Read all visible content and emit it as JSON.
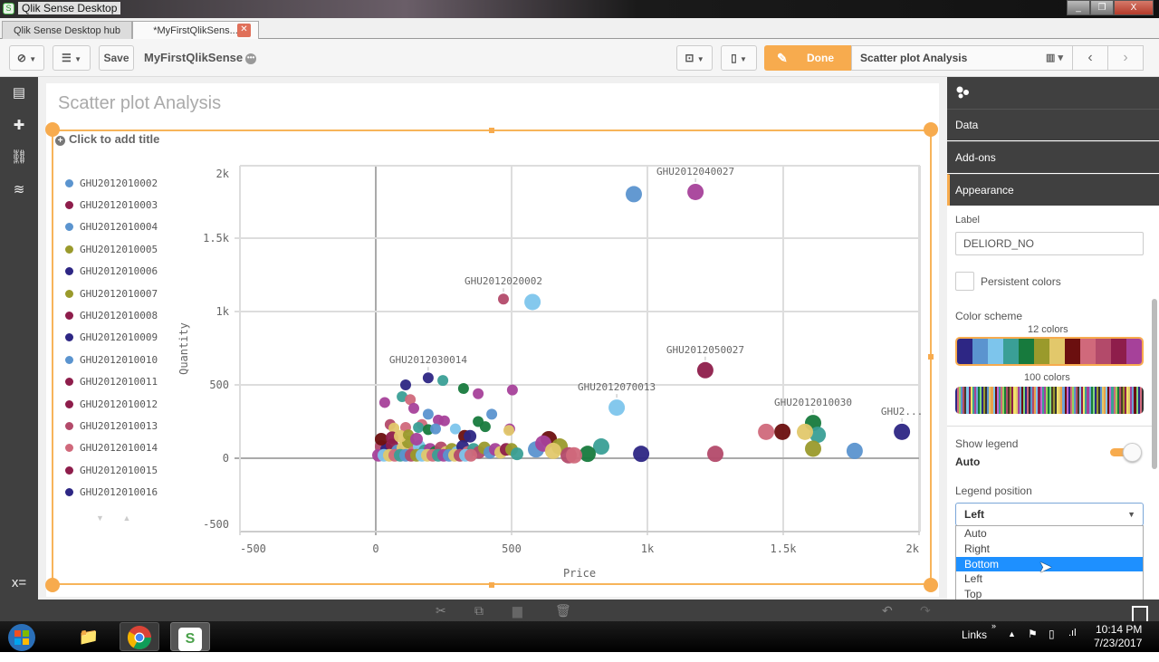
{
  "window": {
    "title": "Qlik Sense Desktop",
    "controls": [
      "minimize",
      "restore",
      "close"
    ]
  },
  "tabs": [
    {
      "label": "Qlik Sense Desktop hub",
      "active": false
    },
    {
      "label": "*MyFirstQlikSens...",
      "active": true,
      "close_icon": "close-icon"
    }
  ],
  "toolbar": {
    "nav_icon": "compass-icon",
    "menu_icon": "list-icon",
    "save_label": "Save",
    "app_name": "MyFirstQlikSense",
    "present_icon": "presentation-icon",
    "bookmark_icon": "bookmark-icon",
    "done_label": "Done",
    "sheet_name": "Scatter plot Analysis",
    "sheet_icon": "chart-icon",
    "prev_icon": "chevron-left-icon",
    "next_icon": "chevron-right-icon",
    "accent_color": "#f7ab4e"
  },
  "leftbar": {
    "icons": [
      "charts-icon",
      "extensions-icon",
      "link-icon",
      "database-icon",
      "variable-icon"
    ]
  },
  "sheet": {
    "title": "Scatter plot Analysis",
    "object_title_placeholder": "Click to add title"
  },
  "legend": {
    "items": [
      {
        "label": "GHU2012010002",
        "color": "#5b94cf"
      },
      {
        "label": "GHU2012010003",
        "color": "#8e1d4b"
      },
      {
        "label": "GHU2012010004",
        "color": "#5b94cf"
      },
      {
        "label": "GHU2012010005",
        "color": "#9a9a2c"
      },
      {
        "label": "GHU2012010006",
        "color": "#2d2684"
      },
      {
        "label": "GHU2012010007",
        "color": "#9a9a2c"
      },
      {
        "label": "GHU2012010008",
        "color": "#8e1d4b"
      },
      {
        "label": "GHU2012010009",
        "color": "#2d2684"
      },
      {
        "label": "GHU2012010010",
        "color": "#5b94cf"
      },
      {
        "label": "GHU2012010011",
        "color": "#8e1d4b"
      },
      {
        "label": "GHU2012010012",
        "color": "#8e1d4b"
      },
      {
        "label": "GHU2012010013",
        "color": "#b34a6a"
      },
      {
        "label": "GHU2012010014",
        "color": "#d0697b"
      },
      {
        "label": "GHU2012010015",
        "color": "#8e1d4b"
      },
      {
        "label": "GHU2012010016",
        "color": "#2d2684"
      }
    ],
    "scroll_down": "▼",
    "scroll_up": "▲"
  },
  "chart_data": {
    "type": "scatter",
    "title": "",
    "xlabel": "Price",
    "ylabel": "Quantity",
    "xlim": [
      -500,
      2000
    ],
    "ylim": [
      -500,
      2000
    ],
    "xticks": [
      {
        "v": -500,
        "label": "-500"
      },
      {
        "v": 0,
        "label": "0"
      },
      {
        "v": 500,
        "label": "500"
      },
      {
        "v": 1000,
        "label": "1k"
      },
      {
        "v": 1500,
        "label": "1.5k"
      },
      {
        "v": 2000,
        "label": "2k"
      }
    ],
    "yticks": [
      {
        "v": -500,
        "label": "-500"
      },
      {
        "v": 0,
        "label": "0"
      },
      {
        "v": 500,
        "label": "500"
      },
      {
        "v": 1000,
        "label": "1k"
      },
      {
        "v": 1500,
        "label": "1.5k"
      },
      {
        "v": 2000,
        "label": "2k"
      }
    ],
    "grid": true,
    "legend_position": "left",
    "points": [
      {
        "x": 950,
        "y": 1800,
        "color": "#5b94cf"
      },
      {
        "x": 1177,
        "y": 1815,
        "color": "#a6419a",
        "label": "GHU2012040027"
      },
      {
        "x": 470,
        "y": 1085,
        "color": "#b34a6a",
        "label": "GHU2012020002"
      },
      {
        "x": 577,
        "y": 1065,
        "color": "#7dc5ec"
      },
      {
        "x": 1213,
        "y": 600,
        "color": "#8e1d4b",
        "label": "GHU2012050027"
      },
      {
        "x": 887,
        "y": 345,
        "color": "#7dc5ec",
        "label": "GHU2012070013"
      },
      {
        "x": 193,
        "y": 548,
        "color": "#2d2684",
        "label": "GHU2012030014"
      },
      {
        "x": 247,
        "y": 530,
        "color": "#3a9f96"
      },
      {
        "x": 323,
        "y": 475,
        "color": "#177a3d"
      },
      {
        "x": 110,
        "y": 500,
        "color": "#2d2684"
      },
      {
        "x": 33,
        "y": 380,
        "color": "#a6419a"
      },
      {
        "x": 97,
        "y": 420,
        "color": "#3a9f96"
      },
      {
        "x": 127,
        "y": 400,
        "color": "#d0697b"
      },
      {
        "x": 377,
        "y": 440,
        "color": "#a6419a"
      },
      {
        "x": 503,
        "y": 465,
        "color": "#a6419a"
      },
      {
        "x": 140,
        "y": 340,
        "color": "#a6419a"
      },
      {
        "x": 193,
        "y": 300,
        "color": "#5b94cf"
      },
      {
        "x": 427,
        "y": 300,
        "color": "#5b94cf"
      },
      {
        "x": 170,
        "y": 230,
        "color": "#d0697b"
      },
      {
        "x": 230,
        "y": 260,
        "color": "#a6419a"
      },
      {
        "x": 253,
        "y": 255,
        "color": "#a6419a"
      },
      {
        "x": 377,
        "y": 250,
        "color": "#177a3d"
      },
      {
        "x": 493,
        "y": 200,
        "color": "#a6419a"
      },
      {
        "x": 157,
        "y": 210,
        "color": "#3a9f96"
      },
      {
        "x": 193,
        "y": 195,
        "color": "#177a3d"
      },
      {
        "x": 220,
        "y": 200,
        "color": "#5b94cf"
      },
      {
        "x": 293,
        "y": 200,
        "color": "#7dc5ec"
      },
      {
        "x": 403,
        "y": 215,
        "color": "#177a3d"
      },
      {
        "x": 490,
        "y": 190,
        "color": "#e2c86b"
      },
      {
        "x": 53,
        "y": 230,
        "color": "#b34a6a"
      },
      {
        "x": 67,
        "y": 205,
        "color": "#e2c86b"
      },
      {
        "x": 110,
        "y": 210,
        "color": "#d0697b"
      },
      {
        "x": 327,
        "y": 150,
        "color": "#6b0f0f"
      },
      {
        "x": 347,
        "y": 150,
        "color": "#2d2684"
      },
      {
        "x": 637,
        "y": 130,
        "color": "#6b0f0f"
      },
      {
        "x": 830,
        "y": 80,
        "color": "#3a9f96"
      },
      {
        "x": 590,
        "y": 60,
        "color": "#5b94cf"
      },
      {
        "x": 617,
        "y": 100,
        "color": "#a6419a"
      },
      {
        "x": 677,
        "y": 80,
        "color": "#9a9a2c"
      },
      {
        "x": 653,
        "y": 50,
        "color": "#e2c86b"
      },
      {
        "x": 780,
        "y": 30,
        "color": "#177a3d"
      },
      {
        "x": 710,
        "y": 20,
        "color": "#b34a6a"
      },
      {
        "x": 730,
        "y": 20,
        "color": "#d0697b"
      },
      {
        "x": 977,
        "y": 30,
        "color": "#2d2684"
      },
      {
        "x": 1250,
        "y": 30,
        "color": "#b34a6a"
      },
      {
        "x": 1437,
        "y": 180,
        "color": "#d0697b"
      },
      {
        "x": 1497,
        "y": 180,
        "color": "#6b0f0f"
      },
      {
        "x": 1610,
        "y": 240,
        "color": "#177a3d",
        "label": "GHU2012010030"
      },
      {
        "x": 1627,
        "y": 160,
        "color": "#3a9f96"
      },
      {
        "x": 1580,
        "y": 180,
        "color": "#e2c86b"
      },
      {
        "x": 1610,
        "y": 65,
        "color": "#9a9a2c"
      },
      {
        "x": 1763,
        "y": 50,
        "color": "#5b94cf"
      },
      {
        "x": 1937,
        "y": 180,
        "color": "#2d2684",
        "label": "GHU2..."
      },
      {
        "x": 20,
        "y": 80,
        "color": "#b34a6a"
      },
      {
        "x": 40,
        "y": 60,
        "color": "#2d2684"
      },
      {
        "x": 60,
        "y": 90,
        "color": "#8e1d4b"
      },
      {
        "x": 80,
        "y": 50,
        "color": "#5b94cf"
      },
      {
        "x": 100,
        "y": 70,
        "color": "#e2c86b"
      },
      {
        "x": 120,
        "y": 110,
        "color": "#9a9a2c"
      },
      {
        "x": 140,
        "y": 40,
        "color": "#d0697b"
      },
      {
        "x": 160,
        "y": 80,
        "color": "#7dc5ec"
      },
      {
        "x": 180,
        "y": 50,
        "color": "#3a9f96"
      },
      {
        "x": 200,
        "y": 60,
        "color": "#a6419a"
      },
      {
        "x": 220,
        "y": 40,
        "color": "#177a3d"
      },
      {
        "x": 240,
        "y": 70,
        "color": "#b34a6a"
      },
      {
        "x": 260,
        "y": 40,
        "color": "#e2c86b"
      },
      {
        "x": 280,
        "y": 60,
        "color": "#9a9a2c"
      },
      {
        "x": 300,
        "y": 40,
        "color": "#7dc5ec"
      },
      {
        "x": 320,
        "y": 80,
        "color": "#2d2684"
      },
      {
        "x": 340,
        "y": 40,
        "color": "#d0697b"
      },
      {
        "x": 360,
        "y": 60,
        "color": "#3a9f96"
      },
      {
        "x": 380,
        "y": 40,
        "color": "#b34a6a"
      },
      {
        "x": 400,
        "y": 70,
        "color": "#9a9a2c"
      },
      {
        "x": 420,
        "y": 40,
        "color": "#5b94cf"
      },
      {
        "x": 440,
        "y": 60,
        "color": "#a6419a"
      },
      {
        "x": 460,
        "y": 40,
        "color": "#e2c86b"
      },
      {
        "x": 480,
        "y": 60,
        "color": "#8e1d4b"
      },
      {
        "x": 500,
        "y": 60,
        "color": "#9a9a2c"
      },
      {
        "x": 520,
        "y": 30,
        "color": "#3a9f96"
      },
      {
        "x": 10,
        "y": 20,
        "color": "#a6419a"
      },
      {
        "x": 30,
        "y": 20,
        "color": "#7dc5ec"
      },
      {
        "x": 50,
        "y": 20,
        "color": "#e2c86b"
      },
      {
        "x": 70,
        "y": 20,
        "color": "#d0697b"
      },
      {
        "x": 90,
        "y": 20,
        "color": "#3a9f96"
      },
      {
        "x": 110,
        "y": 20,
        "color": "#5b94cf"
      },
      {
        "x": 130,
        "y": 20,
        "color": "#b34a6a"
      },
      {
        "x": 150,
        "y": 20,
        "color": "#9a9a2c"
      },
      {
        "x": 170,
        "y": 20,
        "color": "#7dc5ec"
      },
      {
        "x": 190,
        "y": 20,
        "color": "#e2c86b"
      },
      {
        "x": 210,
        "y": 20,
        "color": "#d0697b"
      },
      {
        "x": 230,
        "y": 20,
        "color": "#3a9f96"
      },
      {
        "x": 250,
        "y": 20,
        "color": "#a6419a"
      },
      {
        "x": 270,
        "y": 20,
        "color": "#5b94cf"
      },
      {
        "x": 290,
        "y": 20,
        "color": "#e2c86b"
      },
      {
        "x": 310,
        "y": 20,
        "color": "#b34a6a"
      },
      {
        "x": 330,
        "y": 20,
        "color": "#7dc5ec"
      },
      {
        "x": 350,
        "y": 20,
        "color": "#d0697b"
      },
      {
        "x": 20,
        "y": 130,
        "color": "#6b0f0f"
      },
      {
        "x": 60,
        "y": 140,
        "color": "#8e1d4b"
      },
      {
        "x": 90,
        "y": 150,
        "color": "#e2c86b"
      },
      {
        "x": 120,
        "y": 160,
        "color": "#9a9a2c"
      },
      {
        "x": 150,
        "y": 130,
        "color": "#a6419a"
      }
    ]
  },
  "properties_panel": {
    "header_icon": "scatter-chart-icon",
    "sections": [
      {
        "label": "Data",
        "active": false
      },
      {
        "label": "Add-ons",
        "active": false
      },
      {
        "label": "Appearance",
        "active": true
      }
    ],
    "label_field": {
      "label": "Label",
      "value": "DELIORD_NO"
    },
    "persistent_colors": {
      "label": "Persistent colors",
      "checked": false
    },
    "color_scheme": {
      "label": "Color scheme",
      "option_12_label": "12 colors",
      "option_12_colors": [
        "#2d2684",
        "#5b94cf",
        "#7dc5ec",
        "#3a9f96",
        "#177a3d",
        "#9a9a2c",
        "#e2c86b",
        "#6b0f0f",
        "#d0697b",
        "#b34a6a",
        "#8e1d4b",
        "#a6419a"
      ],
      "option_100_label": "100 colors",
      "selected": "12 colors"
    },
    "show_legend": {
      "label": "Show legend",
      "value": "Auto",
      "on": true
    },
    "legend_position": {
      "label": "Legend position",
      "selected": "Left",
      "options": [
        "Auto",
        "Right",
        "Bottom",
        "Left",
        "Top"
      ],
      "highlighted": "Bottom"
    }
  },
  "bottombar": {
    "icons": [
      "cut-icon",
      "copy-icon",
      "paste-icon",
      "delete-icon",
      "undo-icon",
      "redo-icon"
    ]
  },
  "taskbar": {
    "apps": [
      "start-icon",
      "explorer-icon",
      "chrome-icon",
      "qlik-icon"
    ],
    "links_label": "Links",
    "time": "10:14 PM",
    "date": "7/23/2017"
  }
}
